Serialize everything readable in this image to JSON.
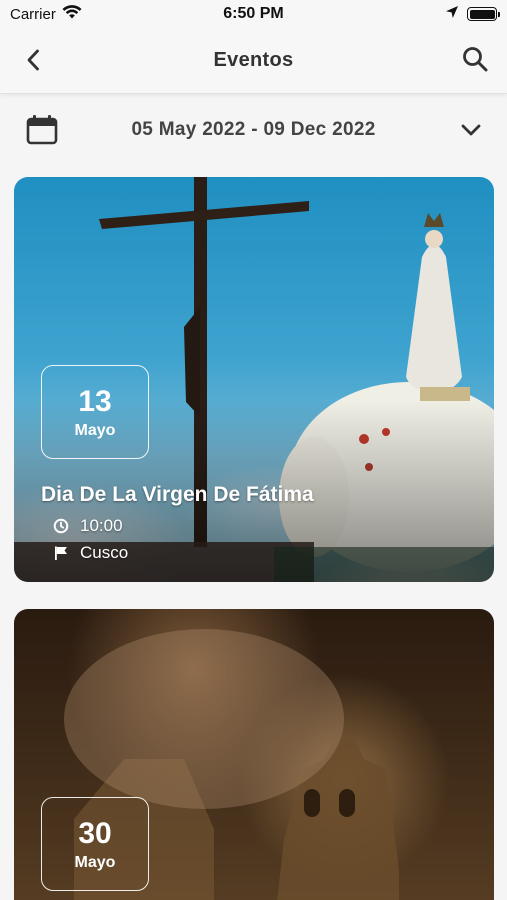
{
  "status_bar": {
    "carrier": "Carrier",
    "time": "6:50 PM"
  },
  "nav": {
    "title": "Eventos"
  },
  "filter": {
    "date_range": "05 May 2022 - 09 Dec 2022"
  },
  "events": [
    {
      "day": "13",
      "month": "Mayo",
      "title": "Dia De La Virgen De Fátima",
      "time": "10:00",
      "place": "Cusco"
    },
    {
      "day": "30",
      "month": "Mayo"
    }
  ],
  "colors": {
    "accent_text": "#444444",
    "nav_bg": "#f7f7f7",
    "page_bg": "#f5f5f5"
  },
  "icons": [
    "wifi-icon",
    "location-arrow-icon",
    "battery-icon",
    "back-icon",
    "search-icon",
    "calendar-icon",
    "chevron-down-icon",
    "clock-icon",
    "flag-icon"
  ]
}
